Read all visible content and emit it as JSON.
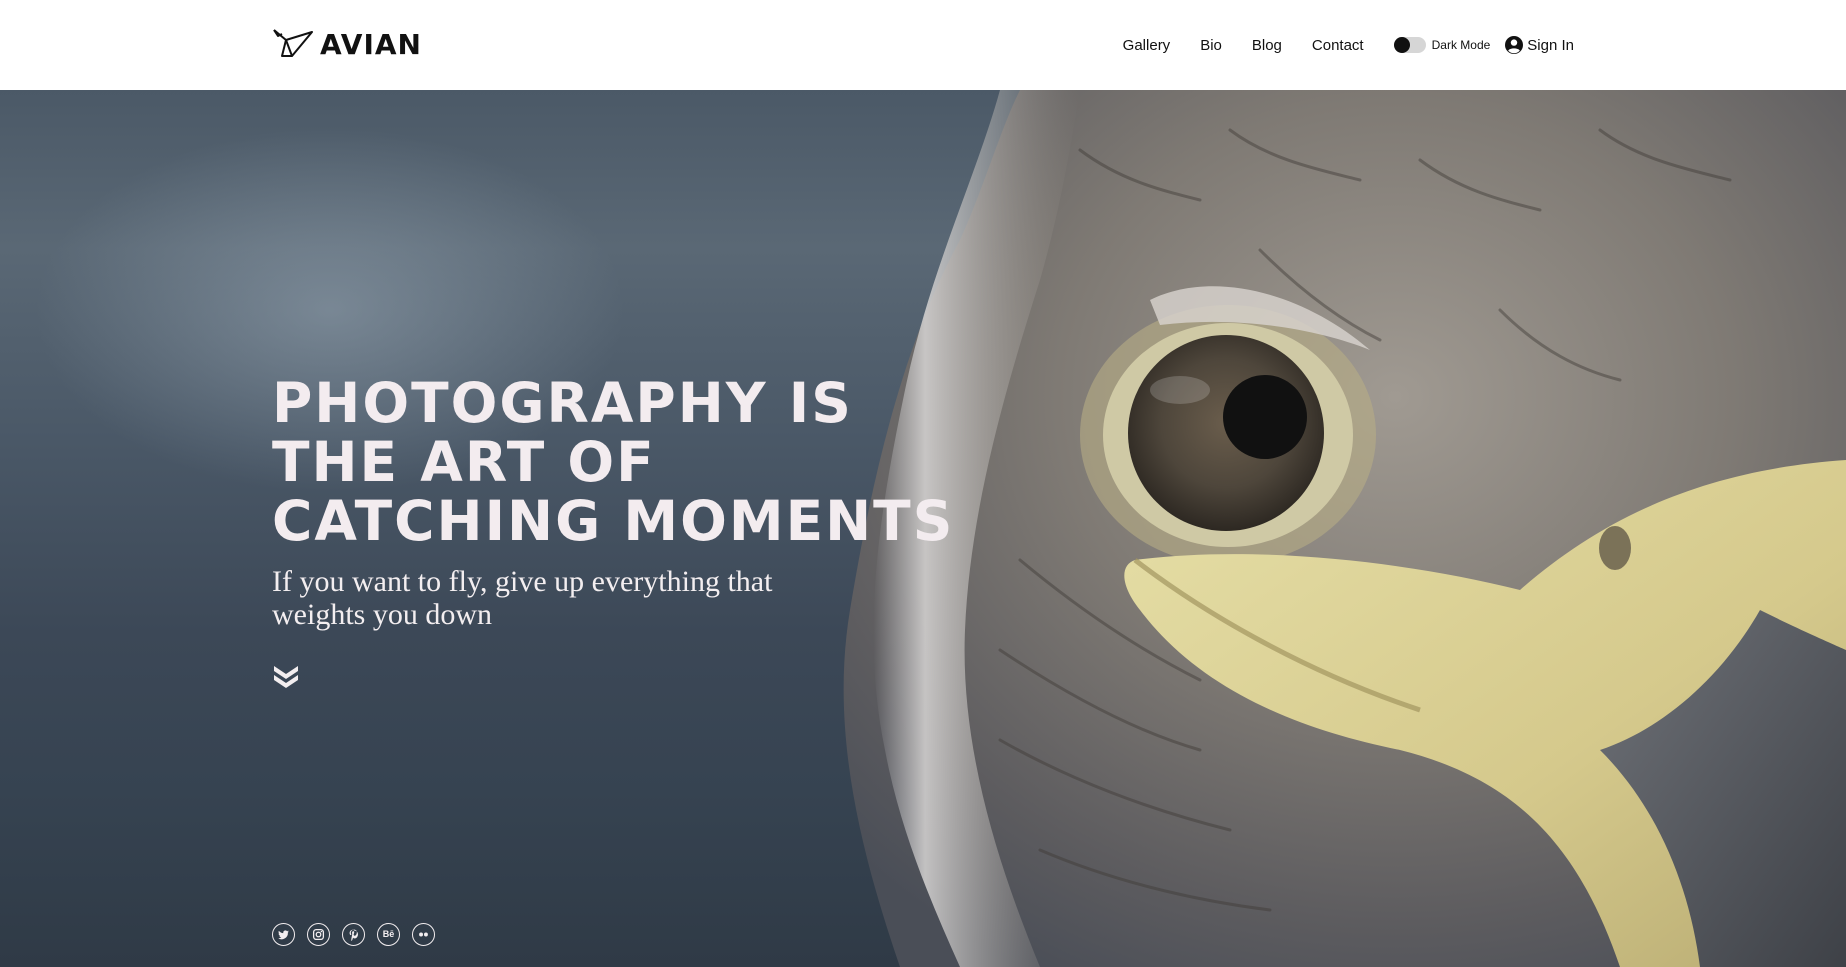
{
  "brand": {
    "name": "AVIAN",
    "logo_icon": "origami-bird-icon"
  },
  "nav": {
    "links": [
      {
        "label": "Gallery"
      },
      {
        "label": "Bio"
      },
      {
        "label": "Blog"
      },
      {
        "label": "Contact"
      }
    ],
    "dark_mode": {
      "label": "Dark Mode",
      "enabled": false
    },
    "sign_in": {
      "label": "Sign In",
      "icon": "user-circle-icon"
    }
  },
  "hero": {
    "headline": "PHOTOGRAPHY IS THE ART OF CATCHING MOMENTS",
    "subline": "If you want to fly, give up everything that weights you down",
    "scroll_icon": "double-chevron-down-icon",
    "image_subject": "close-up of a hawk's eye and beak"
  },
  "socials": [
    {
      "name": "twitter",
      "icon": "twitter-icon"
    },
    {
      "name": "instagram",
      "icon": "instagram-icon"
    },
    {
      "name": "pinterest",
      "icon": "pinterest-icon"
    },
    {
      "name": "behance",
      "icon": "behance-icon",
      "glyph": "Bē"
    },
    {
      "name": "flickr",
      "icon": "flickr-icon"
    }
  ],
  "colors": {
    "header_bg": "#ffffff",
    "text_dark": "#111111",
    "hero_text": "#f3ecef",
    "beak_yellow": "#d8c98a"
  }
}
